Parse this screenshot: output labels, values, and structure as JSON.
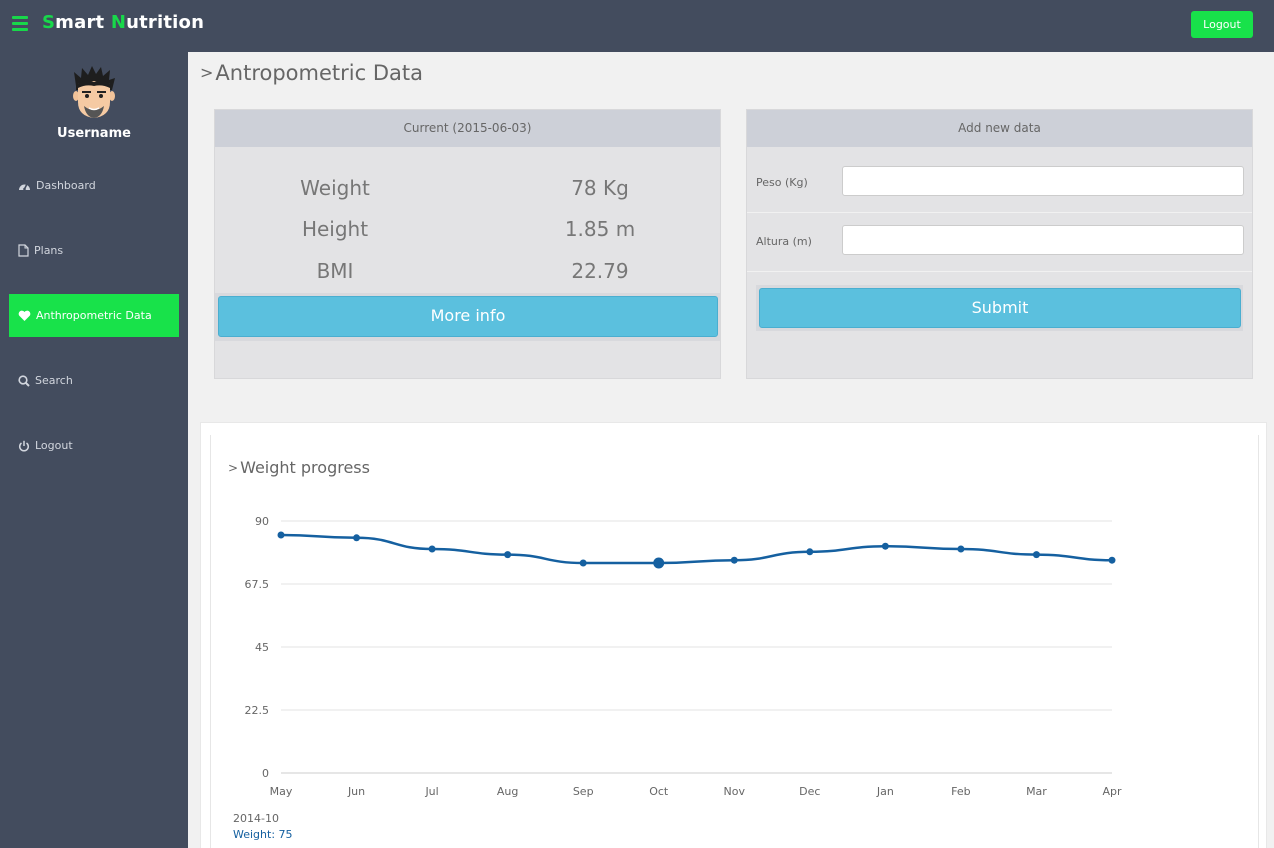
{
  "app": {
    "brand_s": "S",
    "brand_mart": "mart ",
    "brand_n": "N",
    "brand_rest": "utrition",
    "logout_label": "Logout"
  },
  "sidebar": {
    "username": "Username",
    "items": [
      {
        "label": "Dashboard",
        "icon": "dashboard-icon"
      },
      {
        "label": "Plans",
        "icon": "file-icon"
      },
      {
        "label": "Anthropometric Data",
        "icon": "heart-icon",
        "active": true
      },
      {
        "label": "Search",
        "icon": "search-icon"
      },
      {
        "label": "Logout",
        "icon": "power-icon"
      }
    ]
  },
  "main": {
    "title": "Antropometric Data",
    "current": {
      "header": "Current (2015-06-03)",
      "rows": [
        {
          "label": "Weight",
          "value": "78 Kg"
        },
        {
          "label": "Height",
          "value": "1.85 m"
        },
        {
          "label": "BMI",
          "value": "22.79"
        }
      ],
      "more_info_label": "More info"
    },
    "add": {
      "header": "Add new data",
      "peso_label": "Peso (Kg)",
      "peso_value": "",
      "altura_label": "Altura (m)",
      "altura_value": "",
      "submit_label": "Submit"
    }
  },
  "chart_data": {
    "type": "line",
    "title": "Weight progress",
    "categories": [
      "May",
      "Jun",
      "Jul",
      "Aug",
      "Sep",
      "Oct",
      "Nov",
      "Dec",
      "Jan",
      "Feb",
      "Mar",
      "Apr"
    ],
    "series": [
      {
        "name": "Weight",
        "values": [
          85,
          84,
          80,
          78,
          75,
          75,
          76,
          79,
          81,
          80,
          78,
          76
        ]
      }
    ],
    "ylim": [
      0,
      90
    ],
    "yticks": [
      "0",
      "22.5",
      "45",
      "67.5",
      "90"
    ],
    "grid": true,
    "color": "#1560a0",
    "highlight_index": 5,
    "tooltip": {
      "date": "2014-10",
      "text": "Weight: 75"
    }
  },
  "colors": {
    "accent": "#18e24a",
    "sidebar": "#434c5e",
    "info": "#5bc0de",
    "series": "#1560a0"
  }
}
